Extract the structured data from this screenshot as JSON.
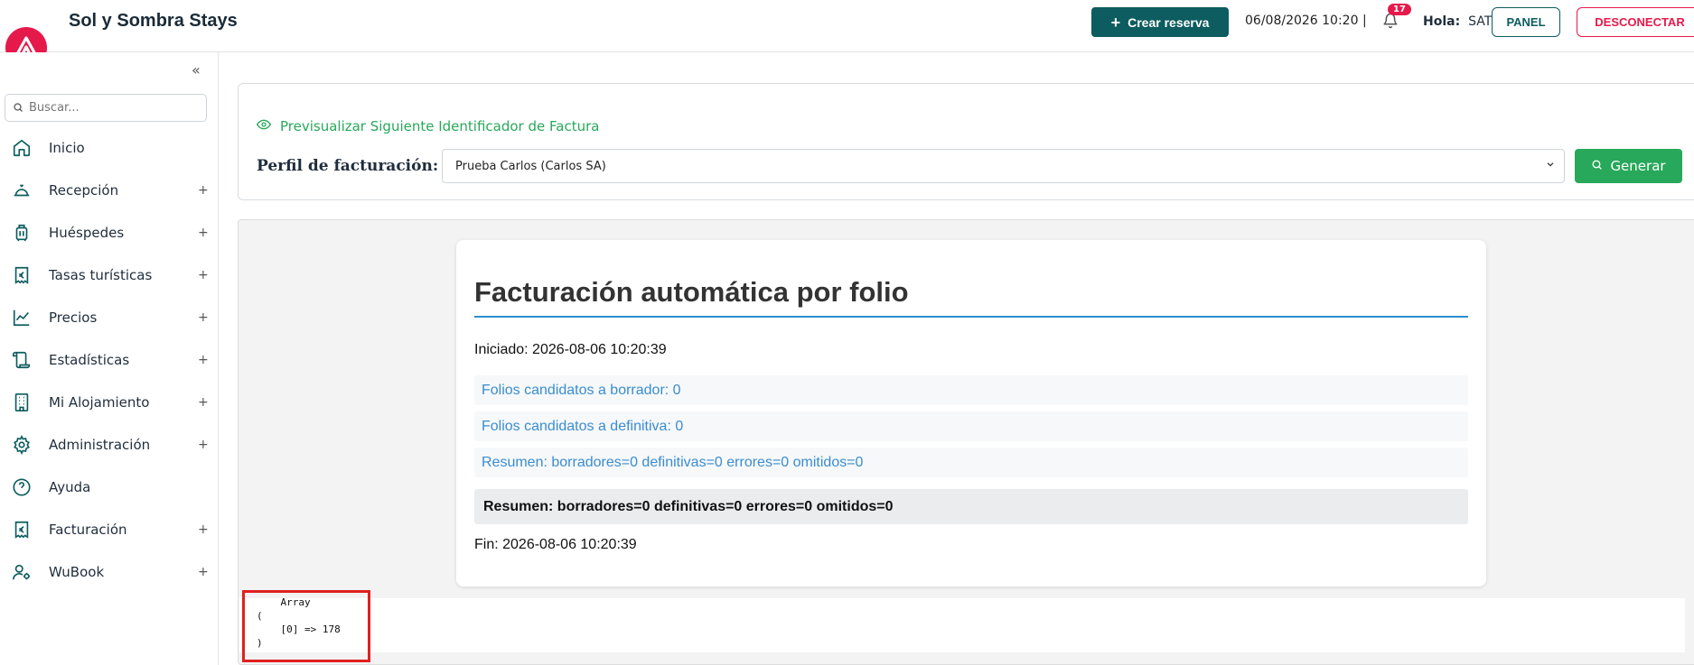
{
  "header": {
    "brand": "Sol y Sombra Stays",
    "create_button": "Crear reserva",
    "datetime": "06/08/2026 10:20 |",
    "notifications_count": "17",
    "greeting_label": "Hola:",
    "user": "SAT",
    "panel_button": "PANEL",
    "logout_button": "DESCONECTAR"
  },
  "sidebar": {
    "search_placeholder": "Buscar...",
    "items": [
      {
        "label": "Inicio",
        "icon": "home-icon",
        "expandable": false
      },
      {
        "label": "Recepción",
        "icon": "bell-service-icon",
        "expandable": true
      },
      {
        "label": "Huéspedes",
        "icon": "luggage-icon",
        "expandable": true
      },
      {
        "label": "Tasas turísticas",
        "icon": "euro-receipt-icon",
        "expandable": true
      },
      {
        "label": "Precios",
        "icon": "chart-line-icon",
        "expandable": true
      },
      {
        "label": "Estadísticas",
        "icon": "scroll-icon",
        "expandable": true
      },
      {
        "label": "Mi Alojamiento",
        "icon": "building-icon",
        "expandable": true
      },
      {
        "label": "Administración",
        "icon": "gear-icon",
        "expandable": true
      },
      {
        "label": "Ayuda",
        "icon": "help-icon",
        "expandable": false
      },
      {
        "label": "Facturación",
        "icon": "euro-receipt-icon",
        "expandable": true
      },
      {
        "label": "WuBook",
        "icon": "user-settings-icon",
        "expandable": true
      }
    ],
    "plus_symbol": "+"
  },
  "invoice_form": {
    "preview_link": "Previsualizar Siguiente Identificador de Factura",
    "profile_label": "Perfil de facturación:",
    "profile_value": "Prueba Carlos (Carlos SA)",
    "generate_button": "Generar"
  },
  "report": {
    "title": "Facturación automática por folio",
    "started": "Iniciado: 2026-08-06 10:20:39",
    "rows": [
      "Folios candidatos a borrador: 0",
      "Folios candidatos a definitiva: 0",
      "Resumen: borradores=0 definitivas=0 errores=0 omitidos=0"
    ],
    "summary": "Resumen: borradores=0 definitivas=0 errores=0 omitidos=0",
    "end": "Fin: 2026-08-06 10:20:39"
  },
  "debug_output": "    Array\n(\n    [0] => 178\n)",
  "colors": {
    "brand_teal": "#0d5c5f",
    "accent_red": "#e6194b",
    "success_green": "#27a85a",
    "info_blue": "#3b8dce",
    "highlight_red": "#e02020"
  }
}
